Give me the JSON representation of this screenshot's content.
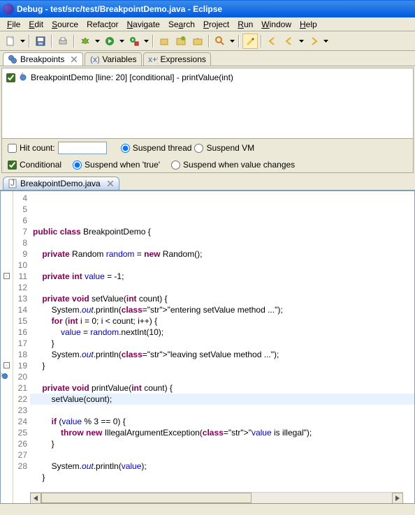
{
  "titlebar": {
    "text": "Debug - test/src/test/BreakpointDemo.java - Eclipse"
  },
  "menubar": {
    "file": "File",
    "edit": "Edit",
    "source": "Source",
    "refactor": "Refactor",
    "navigate": "Navigate",
    "search": "Search",
    "project": "Project",
    "run": "Run",
    "window": "Window",
    "help": "Help"
  },
  "views": {
    "breakpoints": "Breakpoints",
    "variables": "Variables",
    "expressions": "Expressions"
  },
  "breakpoint_entry": "BreakpointDemo [line: 20] [conditional] - printValue(int)",
  "options": {
    "hit_count_label": "Hit count:",
    "hit_count_value": "",
    "suspend_thread": "Suspend thread",
    "suspend_vm": "Suspend VM",
    "conditional": "Conditional",
    "when_true": "Suspend when 'true'",
    "when_changes": "Suspend when value changes"
  },
  "editor": {
    "filename": "BreakpointDemo.java",
    "line_start": 4,
    "line_end": 28,
    "highlight_line": 20,
    "breakpoint_line": 20,
    "fold_lines": [
      11,
      19
    ],
    "lines": {
      "4": "",
      "5": "public class BreakpointDemo {",
      "6": "",
      "7": "    private Random random = new Random();",
      "8": "",
      "9": "    private int value = -1;",
      "10": "",
      "11": "    private void setValue(int count) {",
      "12": "        System.out.println(\"entering setValue method ...\");",
      "13": "        for (int i = 0; i < count; i++) {",
      "14": "            value = random.nextInt(10);",
      "15": "        }",
      "16": "        System.out.println(\"leaving setValue method ...\");",
      "17": "    }",
      "18": "",
      "19": "    private void printValue(int count) {",
      "20": "        setValue(count);",
      "21": "",
      "22": "        if (value % 3 == 0) {",
      "23": "            throw new IllegalArgumentException(\"value is illegal\");",
      "24": "        }",
      "25": "",
      "26": "        System.out.println(value);",
      "27": "    }",
      "28": ""
    }
  }
}
